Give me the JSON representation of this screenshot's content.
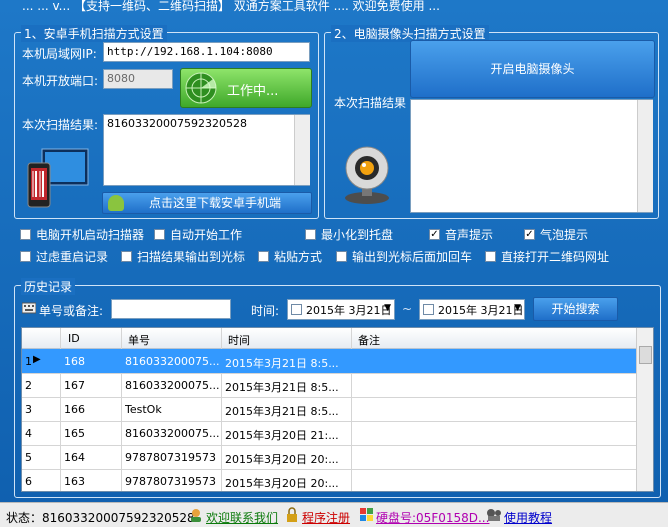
{
  "window": {
    "title": "... ... v... 【支持一维码、二维码扫描】 双通方案工具软件 .... 欢迎免费使用 ..."
  },
  "android": {
    "group_title": "1、安卓手机扫描方式设置",
    "ip_label": "本机局域网IP:",
    "ip_value": "http://192.168.1.104:8080",
    "port_label": "本机开放端口:",
    "port_value": "8080",
    "work_button": "工作中...",
    "result_label": "本次扫描结果:",
    "result_value": "8160332000759232052​8",
    "download_button": "点击这里下载安卓手机端"
  },
  "camera": {
    "group_title": "2、电脑摄像头扫描方式设置",
    "open_button": "开启电脑摄像头",
    "result_label": "本次扫描结果"
  },
  "options": {
    "row1": [
      {
        "label": "电脑开机启动扫描器",
        "checked": false
      },
      {
        "label": "自动开始工作",
        "checked": false
      },
      {
        "label": "最小化到托盘",
        "checked": false
      },
      {
        "label": "音声提示",
        "checked": true
      },
      {
        "label": "气泡提示",
        "checked": true
      }
    ],
    "row2": [
      {
        "label": "过虑重启记录",
        "checked": false
      },
      {
        "label": "扫描结果输出到光标",
        "checked": false
      },
      {
        "label": "粘贴方式",
        "checked": false
      },
      {
        "label": "输出到光标后面加回车",
        "checked": false
      },
      {
        "label": "直接打开二维码网址",
        "checked": false
      }
    ]
  },
  "history": {
    "group_title": "历史记录",
    "search_label": "单号或备注:",
    "search_value": "",
    "time_label": "时间:",
    "date_from": "2015年 3月21日",
    "tilde": "~",
    "date_to": "2015年 3月21日",
    "search_button": "开始搜索",
    "columns": [
      "ID",
      "单号",
      "时间",
      "备注"
    ],
    "rows": [
      {
        "num": "1",
        "id": "168",
        "code": "816033200075...",
        "time": "2015年3月21日 8:5...",
        "note": ""
      },
      {
        "num": "2",
        "id": "167",
        "code": "816033200075...",
        "time": "2015年3月21日 8:5...",
        "note": ""
      },
      {
        "num": "3",
        "id": "166",
        "code": "TestOk",
        "time": "2015年3月21日 8:5...",
        "note": ""
      },
      {
        "num": "4",
        "id": "165",
        "code": "816033200075...",
        "time": "2015年3月20日 21:...",
        "note": ""
      },
      {
        "num": "5",
        "id": "164",
        "code": "9787807319573",
        "time": "2015年3月20日 20:...",
        "note": ""
      },
      {
        "num": "6",
        "id": "163",
        "code": "9787807319573",
        "time": "2015年3月20日 20:...",
        "note": ""
      }
    ]
  },
  "statusbar": {
    "status_text": "状态：8160332000759232052​8",
    "contact": "欢迎联系我们",
    "register": "程序注册",
    "disk": "硬盘号:05F0158D...",
    "tutorial": "使用教程"
  },
  "colors": {
    "window_bg": "#1a6fc1",
    "selected_row": "#3399ff",
    "green_button": "#3fa82a"
  }
}
